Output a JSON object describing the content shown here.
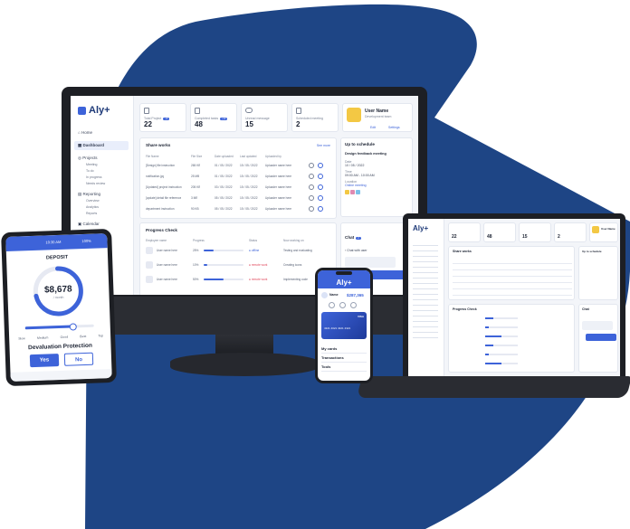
{
  "colors": {
    "navy": "#1e4585",
    "accent": "#3d63d9",
    "yellow": "#f3c844",
    "bg": "#f3f5f9"
  },
  "brand": "Aly+",
  "monitor": {
    "nav": {
      "home": "Home",
      "dashboard": "Dashboard",
      "projects": "Projects",
      "project_items": [
        "Meeting",
        "To do",
        "In progress",
        "Needs review"
      ],
      "reporting": "Reporting",
      "reporting_items": [
        "Overview",
        "Analytics",
        "Reports"
      ],
      "calendar": "Calendar"
    },
    "stats": [
      {
        "label": "Total Project",
        "badge": "+3",
        "value": "22"
      },
      {
        "label": "Completed tasks",
        "badge": "+12",
        "value": "48"
      },
      {
        "label": "Unread message",
        "badge": "",
        "value": "15"
      },
      {
        "label": "Scheduled meeting",
        "badge": "",
        "value": "2"
      }
    ],
    "user": {
      "name": "User Name",
      "subtitle": "Development team",
      "edit": "Edit",
      "settings": "Settings"
    },
    "share": {
      "title": "Share works",
      "see_more": "See more",
      "columns": [
        "File Name",
        "File Size",
        "Date uploaded",
        "Last updated",
        "Uploaded by"
      ],
      "rows": [
        [
          "[Design] file instruction",
          "265 KB",
          "01 / 05 / 2022",
          "15 / 05 / 2022",
          "Uploader name here"
        ],
        [
          "notification.jpg",
          "25 MB",
          "01 / 05 / 2022",
          "15 / 05 / 2022",
          "Uploader name here"
        ],
        [
          "[Updated] project instruction",
          "205 KB",
          "03 / 05 / 2022",
          "15 / 05 / 2022",
          "Uploader name here"
        ],
        [
          "[update] detail file reference",
          "3 MB",
          "05 / 05 / 2022",
          "15 / 05 / 2022",
          "Uploader name here"
        ],
        [
          "department instruction",
          "90 KB",
          "05 / 05 / 2022",
          "15 / 05 / 2022",
          "Uploader name here"
        ]
      ]
    },
    "schedule": {
      "title": "Up to schedule",
      "meeting": "Design feedback meeting",
      "date_label": "Date",
      "date": "10 / 05 / 2022",
      "time_label": "Time",
      "time": "09:00 AM - 10:00 AM",
      "location_label": "Location",
      "location": "Online meeting"
    },
    "progress": {
      "title": "Progress Check",
      "columns": [
        "Employee name",
        "Progress",
        "Status",
        "Now working on"
      ],
      "rows": [
        {
          "name": "User name here",
          "pct": "25%",
          "fill": 0.25,
          "status": "offline",
          "work": "Testing and evaluating"
        },
        {
          "name": "User name here",
          "pct": "10%",
          "fill": 0.1,
          "status": "remote work",
          "work": "Creating icons"
        },
        {
          "name": "User name here",
          "pct": "50%",
          "fill": 0.5,
          "status": "remote work",
          "work": "Implementing code"
        }
      ]
    },
    "chat": {
      "title": "Chat",
      "count": "2",
      "with": "Chat with user"
    }
  },
  "tablet": {
    "time": "10:30 AM",
    "battery": "100%",
    "title": "DEPOSIT",
    "amount": "$8,678",
    "period": "/ month",
    "slider_fill": 0.7,
    "scale": [
      "Slow",
      "Medium",
      "Good",
      "Best",
      "Top"
    ],
    "question": "Devaluation Protection",
    "yes": "Yes",
    "no": "No"
  },
  "phone": {
    "brand": "Aly+",
    "name": "Name",
    "balance": "$287,365",
    "card_number": "4321 4321 4321 4321",
    "card_type": "VISA",
    "menu": [
      "My cards",
      "Transactions",
      "Tools"
    ]
  },
  "laptop": {
    "stats": [
      "22",
      "48",
      "15",
      "2"
    ],
    "user": "User Name",
    "share_title": "Share works",
    "schedule_title": "Up to schedule",
    "progress_title": "Progress Check",
    "chat_title": "Chat"
  }
}
